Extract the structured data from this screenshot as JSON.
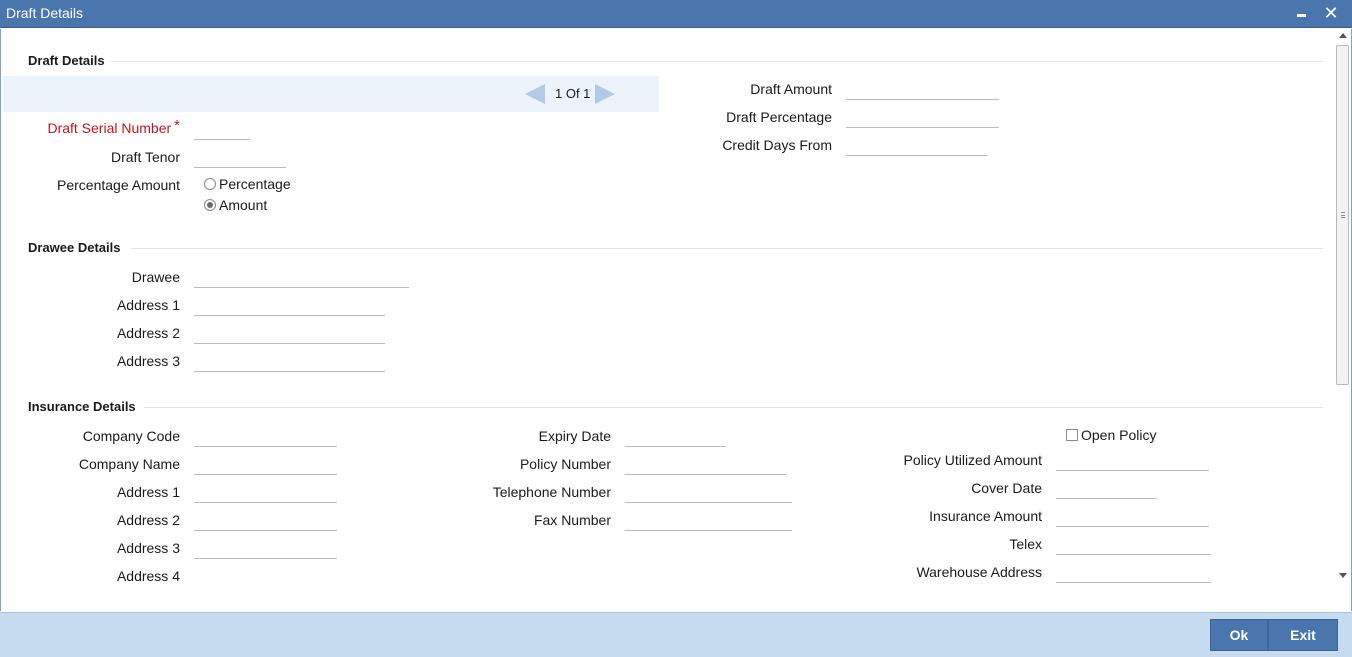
{
  "window": {
    "title": "Draft Details",
    "minimize_icon": "minimize-icon",
    "close_icon": "close-icon",
    "close_glyph": "✕"
  },
  "draft_details": {
    "section_title": "Draft Details",
    "pager": {
      "text": "1 Of 1",
      "prev_icon": "triangle-left-icon",
      "next_icon": "triangle-right-icon"
    },
    "draft_serial_number_label": "Draft Serial Number",
    "required_mark": "*",
    "draft_serial_number_value": "",
    "draft_tenor_label": "Draft Tenor",
    "draft_tenor_value": "",
    "percentage_amount_label": "Percentage Amount",
    "options": {
      "percentage": "Percentage",
      "amount": "Amount"
    },
    "selected_option": "Amount",
    "draft_amount_label": "Draft Amount",
    "draft_amount_value": "",
    "draft_percentage_label": "Draft Percentage",
    "draft_percentage_value": "",
    "credit_days_from_label": "Credit Days From",
    "credit_days_from_value": ""
  },
  "drawee_details": {
    "section_title": "Drawee Details",
    "drawee_label": "Drawee",
    "address1_label": "Address 1",
    "address2_label": "Address 2",
    "address3_label": "Address 3"
  },
  "insurance_details": {
    "section_title": "Insurance Details",
    "company_code_label": "Company Code",
    "company_name_label": "Company Name",
    "address1_label": "Address 1",
    "address2_label": "Address 2",
    "address3_label": "Address 3",
    "address4_label": "Address 4",
    "expiry_date_label": "Expiry Date",
    "policy_number_label": "Policy Number",
    "telephone_number_label": "Telephone Number",
    "fax_number_label": "Fax Number",
    "open_policy_label": "Open Policy",
    "open_policy_checked": false,
    "policy_utilized_amount_label": "Policy Utilized Amount",
    "cover_date_label": "Cover Date",
    "insurance_amount_label": "Insurance Amount",
    "telex_label": "Telex",
    "warehouse_address_label": "Warehouse Address"
  },
  "footer": {
    "ok_label": "Ok",
    "exit_label": "Exit"
  },
  "colors": {
    "titlebar": "#4a75ad",
    "footer": "#c6dbf0",
    "required": "#c0141e",
    "pager_strip": "#edf3fb"
  }
}
